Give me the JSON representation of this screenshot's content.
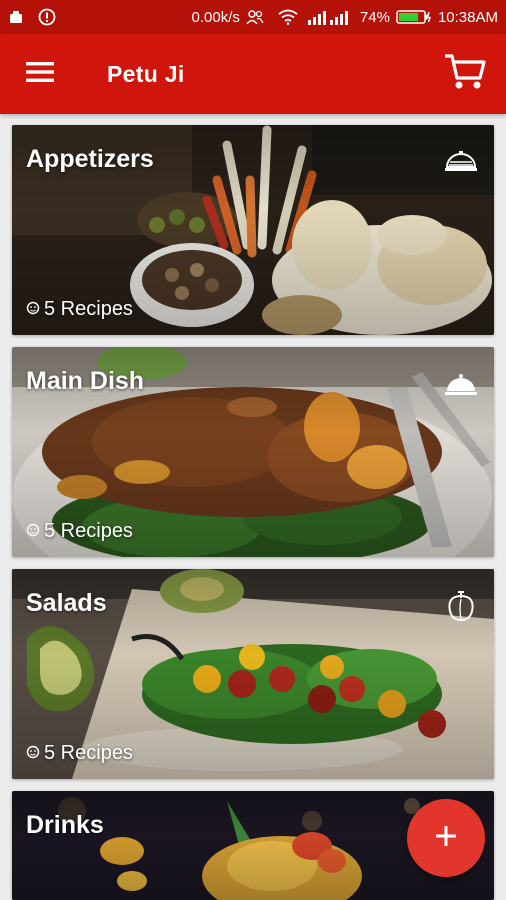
{
  "status_bar": {
    "speed": "0.00k/s",
    "battery": "74%",
    "time": "10:38AM",
    "icons": [
      "notification-icon",
      "info-icon",
      "people-icon",
      "wifi-icon",
      "signal-icon",
      "battery-icon"
    ]
  },
  "app_bar": {
    "title": "Petu Ji",
    "menu_icon": "hamburger-menu-icon",
    "cart_icon": "shopping-cart-icon"
  },
  "categories": [
    {
      "title": "Appetizers",
      "recipes": "5 Recipes",
      "icon": "covered-dish-icon"
    },
    {
      "title": "Main Dish",
      "recipes": "5 Recipes",
      "icon": "cloche-icon"
    },
    {
      "title": "Salads",
      "recipes": "5 Recipes",
      "icon": "bell-pepper-icon"
    },
    {
      "title": "Drinks",
      "recipes": "",
      "icon": ""
    }
  ],
  "fab": {
    "icon": "plus-icon"
  },
  "colors": {
    "status_bar": "#b41108",
    "app_bar": "#d0150c",
    "fab": "#e2352c"
  }
}
